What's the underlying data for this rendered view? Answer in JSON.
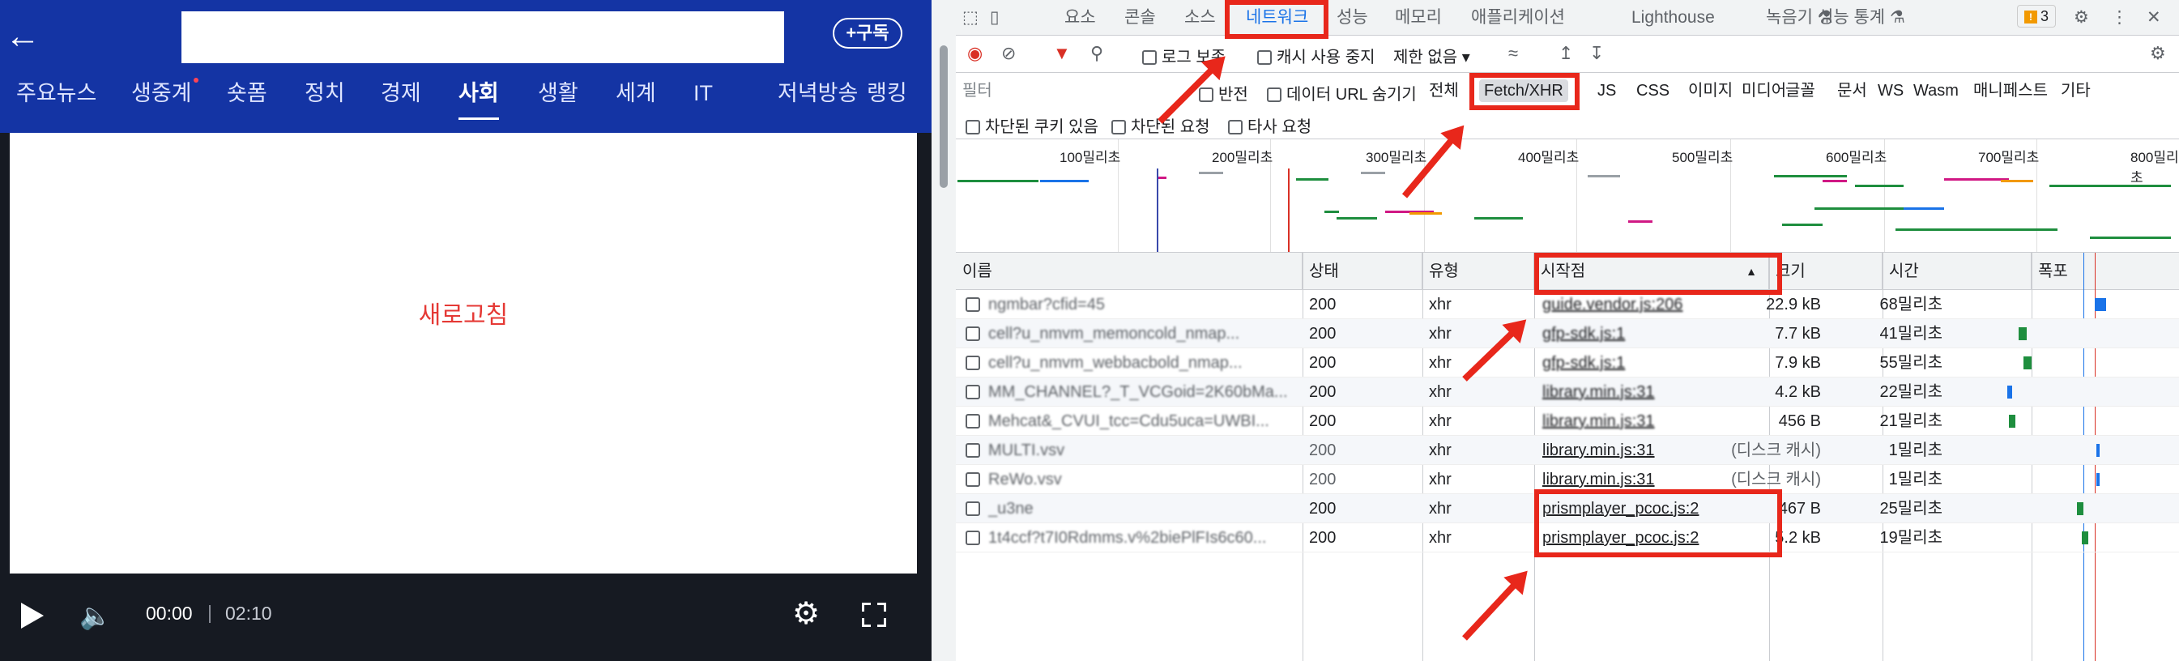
{
  "mobile": {
    "back_icon": "arrow-left-icon",
    "subscribe_label": "+구독",
    "nav": [
      {
        "label": "주요뉴스",
        "active": false,
        "dot": false
      },
      {
        "label": "생중계",
        "active": false,
        "dot": true
      },
      {
        "label": "숏폼",
        "active": false,
        "dot": false
      },
      {
        "label": "정치",
        "active": false,
        "dot": false
      },
      {
        "label": "경제",
        "active": false,
        "dot": false
      },
      {
        "label": "사회",
        "active": true,
        "dot": false
      },
      {
        "label": "생활",
        "active": false,
        "dot": false
      },
      {
        "label": "세계",
        "active": false,
        "dot": false
      },
      {
        "label": "IT",
        "active": false,
        "dot": false
      },
      {
        "label": "저녁방송",
        "active": false,
        "dot": false
      },
      {
        "label": "랭킹",
        "active": false,
        "dot": false
      }
    ],
    "refresh_text": "새로고침",
    "player": {
      "current_time": "00:00",
      "separator": "|",
      "duration": "02:10"
    }
  },
  "devtools": {
    "tabs": [
      "요소",
      "콘솔",
      "소스",
      "네트워크",
      "성능",
      "메모리",
      "애플리케이션",
      "Lighthouse",
      "녹음기 ⚗",
      "성능 통계 ⚗"
    ],
    "active_tab": "네트워크",
    "issues_count": "3",
    "toolbar": {
      "preserve_log": "로그 보존",
      "disable_cache": "캐시 사용 중지",
      "throttle": "제한 없음"
    },
    "filter": {
      "placeholder": "필터",
      "invert": "반전",
      "hide_data_urls": "데이터 URL 숨기기",
      "types": [
        "전체",
        "Fetch/XHR",
        "JS",
        "CSS",
        "이미지",
        "미디어",
        "글꼴",
        "문서",
        "WS",
        "Wasm",
        "매니페스트",
        "기타"
      ],
      "selected_type": "Fetch/XHR",
      "blocked_cookies": "차단된 쿠키 있음",
      "blocked_requests": "차단된 요청",
      "third_party": "타사 요청"
    },
    "timeline_ticks": [
      "100밀리초",
      "200밀리초",
      "300밀리초",
      "400밀리초",
      "500밀리초",
      "600밀리초",
      "700밀리초",
      "800밀리초"
    ],
    "columns": [
      "이름",
      "상태",
      "유형",
      "시작점",
      "크기",
      "시간",
      "폭포"
    ],
    "rows": [
      {
        "name": "ngmbar?cfid=45",
        "status": "200",
        "type": "xhr",
        "initiator": "guide.vendor.js:206",
        "size": "22.9 kB",
        "time": "68밀리초"
      },
      {
        "name": "cell?u_nmvm_memoncold_nmap...",
        "status": "200",
        "type": "xhr",
        "initiator": "gfp-sdk.js:1",
        "size": "7.7 kB",
        "time": "41밀리초"
      },
      {
        "name": "cell?u_nmvm_webbacbold_nmap...",
        "status": "200",
        "type": "xhr",
        "initiator": "gfp-sdk.js:1",
        "size": "7.9 kB",
        "time": "55밀리초"
      },
      {
        "name": "MM_CHANNEL?_T_VCGoid=2K60bMa...",
        "status": "200",
        "type": "xhr",
        "initiator": "library.min.js:31",
        "size": "4.2 kB",
        "time": "22밀리초"
      },
      {
        "name": "Mehcat&_CVUI_tcc=Cdu5uca=UWBI...",
        "status": "200",
        "type": "xhr",
        "initiator": "library.min.js:31",
        "size": "456 B",
        "time": "21밀리초"
      },
      {
        "name": "MULTI.vsv",
        "status": "200",
        "type": "xhr",
        "initiator": "library.min.js:31",
        "size": "(디스크 캐시)",
        "time": "1밀리초"
      },
      {
        "name": "ReWo.vsv",
        "status": "200",
        "type": "xhr",
        "initiator": "library.min.js:31",
        "size": "(디스크 캐시)",
        "time": "1밀리초"
      },
      {
        "name": "_u3ne",
        "status": "200",
        "type": "xhr",
        "initiator": "prismplayer_pcoc.js:2",
        "size": "467 B",
        "time": "25밀리초"
      },
      {
        "name": "1t4ccf?t7I0Rdmms.v%2biePlFIs6c60...",
        "status": "200",
        "type": "xhr",
        "initiator": "prismplayer_pcoc.js:2",
        "size": "5.2 kB",
        "time": "19밀리초"
      }
    ],
    "colors": {
      "accent": "#1a73e8",
      "annotation": "#e8271b",
      "nav_bg": "#1434a4"
    }
  }
}
